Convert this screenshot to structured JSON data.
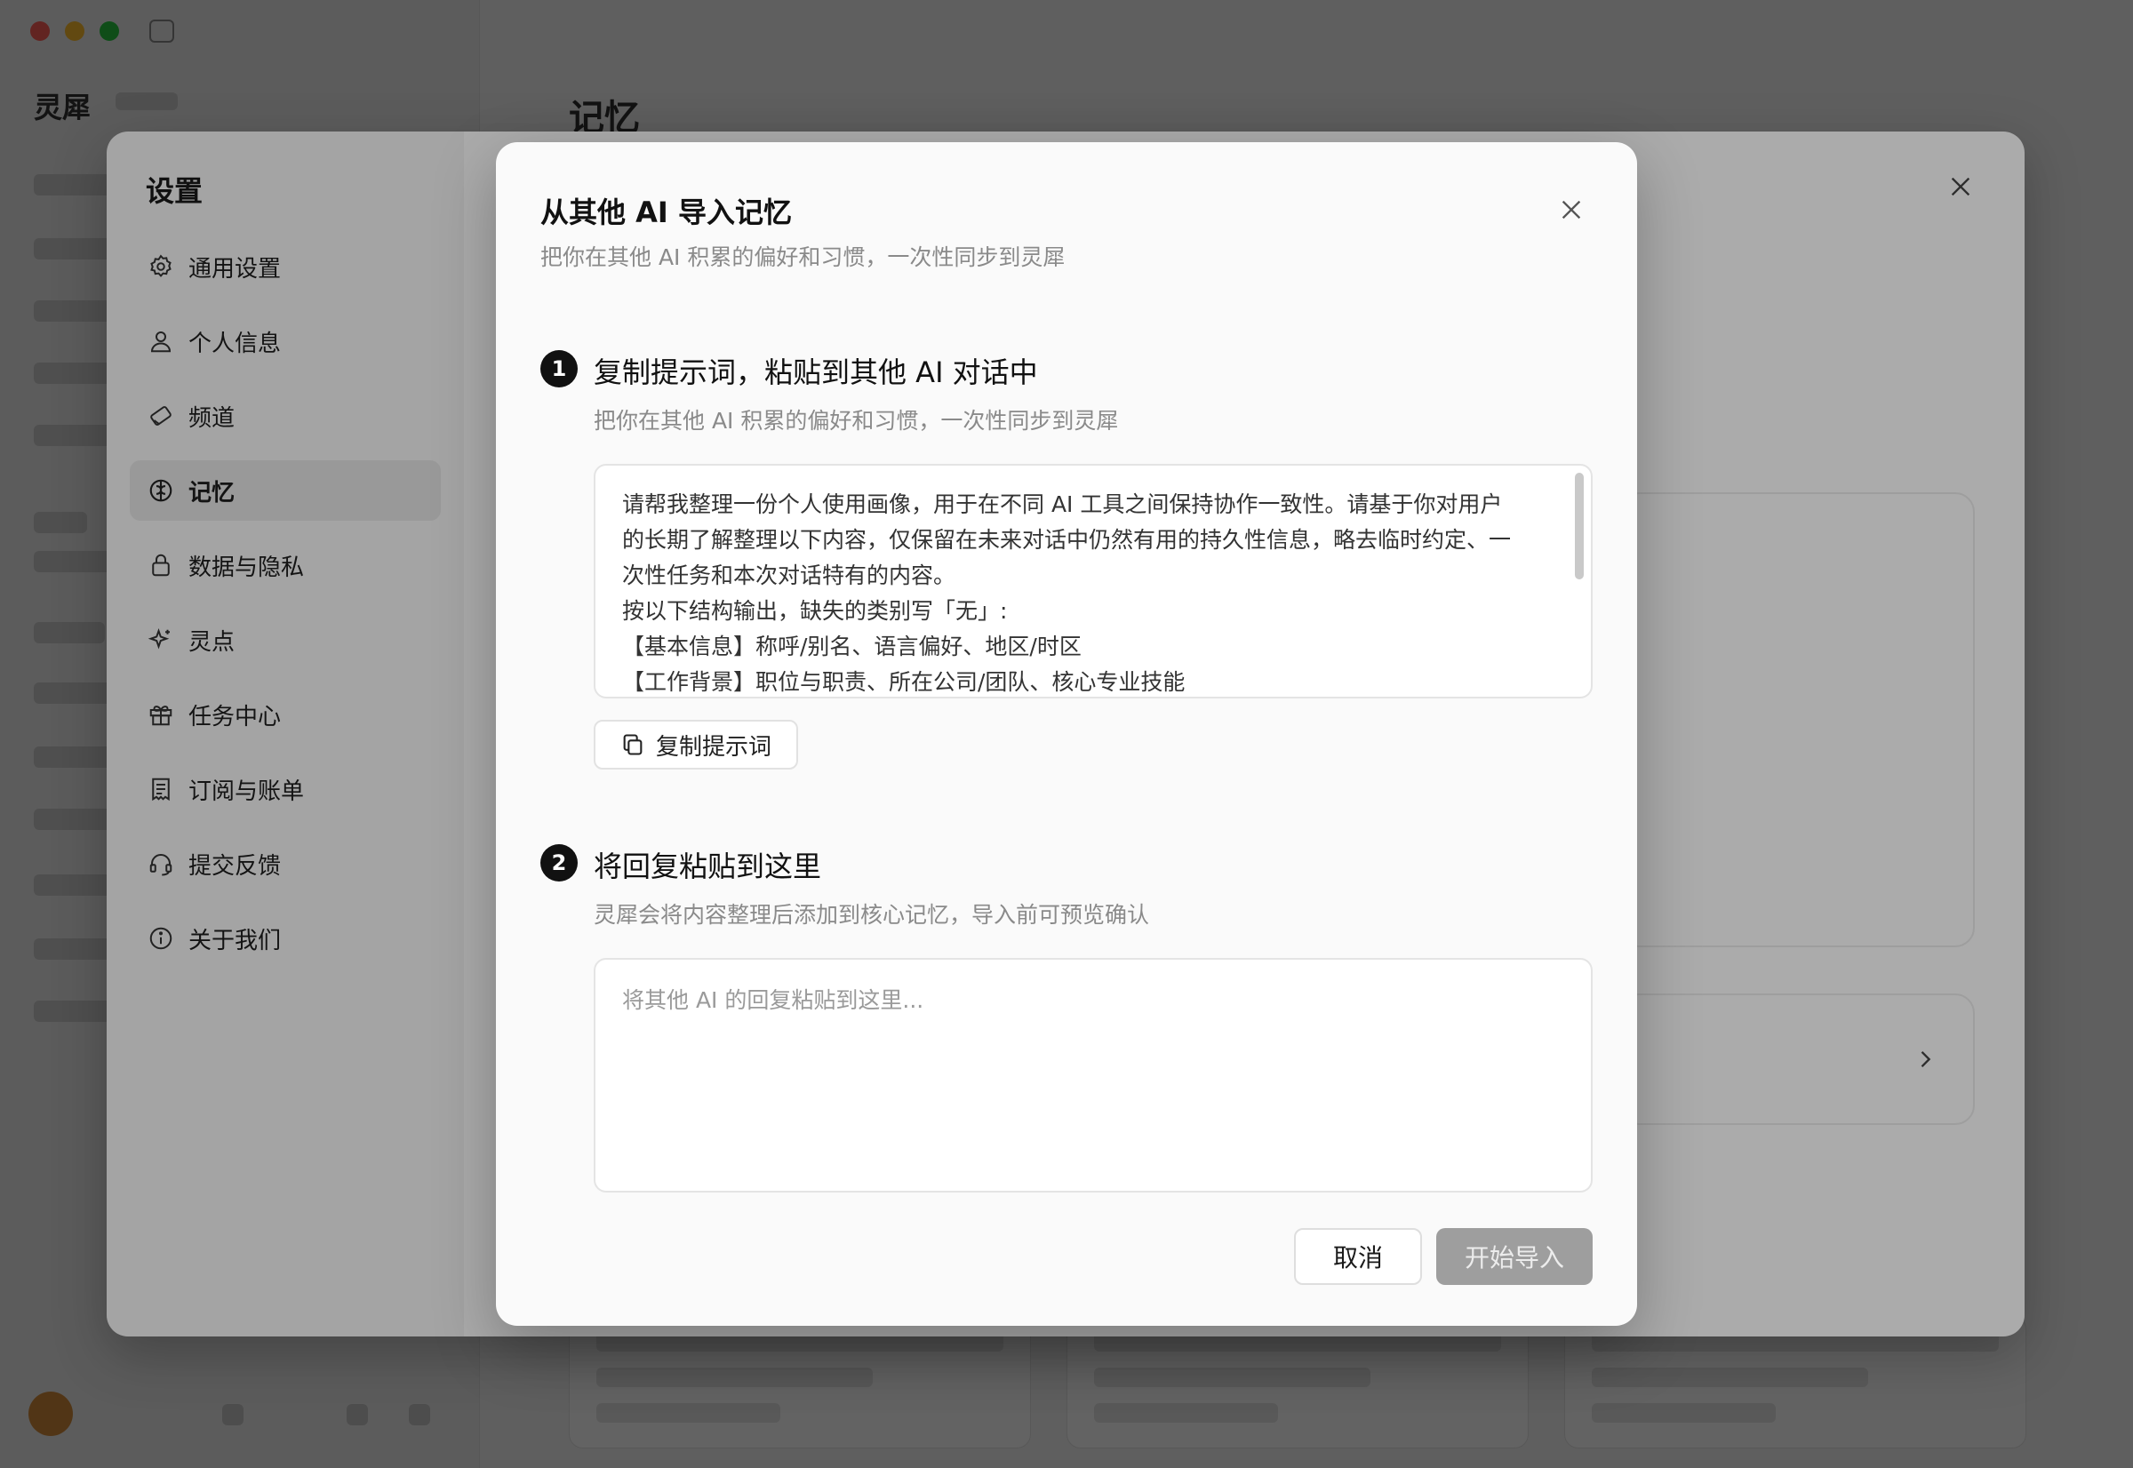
{
  "settings": {
    "title": "设置",
    "nav": [
      {
        "label": "通用设置",
        "icon": "gear-icon"
      },
      {
        "label": "个人信息",
        "icon": "user-icon"
      },
      {
        "label": "频道",
        "icon": "channel-icon"
      },
      {
        "label": "记忆",
        "icon": "brain-icon",
        "active": true
      },
      {
        "label": "数据与隐私",
        "icon": "lock-icon"
      },
      {
        "label": "灵点",
        "icon": "sparkle-icon"
      },
      {
        "label": "任务中心",
        "icon": "gift-icon"
      },
      {
        "label": "订阅与账单",
        "icon": "receipt-icon"
      },
      {
        "label": "提交反馈",
        "icon": "headset-icon"
      },
      {
        "label": "关于我们",
        "icon": "info-icon"
      }
    ]
  },
  "modal": {
    "title": "从其他 AI 导入记忆",
    "subtitle": "把你在其他 AI 积累的偏好和习惯，一次性同步到灵犀",
    "step1": {
      "number": "1",
      "title": "复制提示词，粘贴到其他 AI 对话中",
      "description": "把你在其他 AI 积累的偏好和习惯，一次性同步到灵犀",
      "prompt_lines": [
        "请帮我整理一份个人使用画像，用于在不同 AI 工具之间保持协作一致性。请基于你对用户",
        "的长期了解整理以下内容，仅保留在未来对话中仍然有用的持久性信息，略去临时约定、一",
        "次性任务和本次对话特有的内容。",
        "按以下结构输出，缺失的类别写「无」:",
        "【基本信息】称呼/别名、语言偏好、地区/时区",
        "【工作背景】职位与职责、所在公司/团队、核心专业技能"
      ],
      "copy_button": "复制提示词"
    },
    "step2": {
      "number": "2",
      "title": "将回复粘贴到这里",
      "description": "灵犀会将内容整理后添加到核心记忆，导入前可预览确认",
      "reply_placeholder": "将其他 AI 的回复粘贴到这里..."
    },
    "cancel_button": "取消",
    "import_button": "开始导入"
  },
  "background": {
    "brand": "灵犀",
    "main_title": "记忆"
  },
  "colors": {
    "step_badge": "#111111",
    "import_button_disabled": "#9e9e9e",
    "active_nav": "#e4e4e4"
  }
}
